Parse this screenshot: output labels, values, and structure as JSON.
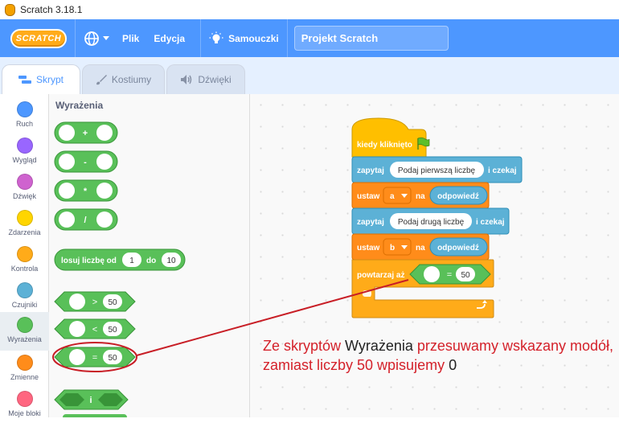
{
  "window": {
    "title": "Scratch 3.18.1"
  },
  "menubar": {
    "logo": "SCRATCH",
    "menu_file": "Plik",
    "menu_edit": "Edycja",
    "tutorials": "Samouczki",
    "project_title": "Projekt Scratch"
  },
  "tabs": [
    {
      "label": "Skrypt"
    },
    {
      "label": "Kostiumy"
    },
    {
      "label": "Dźwięki"
    }
  ],
  "categories": [
    {
      "label": "Ruch",
      "color": "#4c97ff"
    },
    {
      "label": "Wygląd",
      "color": "#9966ff"
    },
    {
      "label": "Dźwięk",
      "color": "#cf63cf"
    },
    {
      "label": "Zdarzenia",
      "color": "#ffd500"
    },
    {
      "label": "Kontrola",
      "color": "#ffab19"
    },
    {
      "label": "Czujniki",
      "color": "#5cb1d6"
    },
    {
      "label": "Wyrażenia",
      "color": "#59c059"
    },
    {
      "label": "Zmienne",
      "color": "#ff8c1a"
    },
    {
      "label": "Moje bloki",
      "color": "#ff6680"
    }
  ],
  "palette": {
    "title": "Wyrażenia",
    "ops": [
      "+",
      "-",
      "*",
      "/"
    ],
    "random": {
      "label1": "losuj liczbę od",
      "from": "1",
      "label2": "do",
      "to": "10"
    },
    "compare": [
      {
        "op": ">",
        "value": "50"
      },
      {
        "op": "<",
        "value": "50"
      },
      {
        "op": "=",
        "value": "50"
      }
    ],
    "and_label": "i"
  },
  "script": {
    "hat": "kiedy kliknięto",
    "ask1": {
      "label": "zapytaj",
      "text": "Podaj pierwszą liczbę",
      "suffix": "i czekaj"
    },
    "set1": {
      "label": "ustaw",
      "var": "a",
      "to": "na",
      "value": "odpowiedź"
    },
    "ask2": {
      "label": "zapytaj",
      "text": "Podaj drugą liczbę",
      "suffix": "i czekaj"
    },
    "set2": {
      "label": "ustaw",
      "var": "b",
      "to": "na",
      "value": "odpowiedź"
    },
    "repeat": {
      "label": "powtarzaj aż",
      "op": "=",
      "value": "50"
    }
  },
  "annotation": {
    "part1": "Ze skryptów ",
    "part2": "Wyrażenia",
    "part3": " przesuwamy wskazany modół, zamiast liczby 50 wpisujemy ",
    "part4": "0"
  },
  "colors": {
    "brand": "#4d97ff",
    "operators": "#59c059",
    "sensing": "#5cb1d6",
    "variables": "#ff8c1a",
    "control": "#ffab19",
    "events": "#ffbf00",
    "annotation": "#d4212a"
  }
}
